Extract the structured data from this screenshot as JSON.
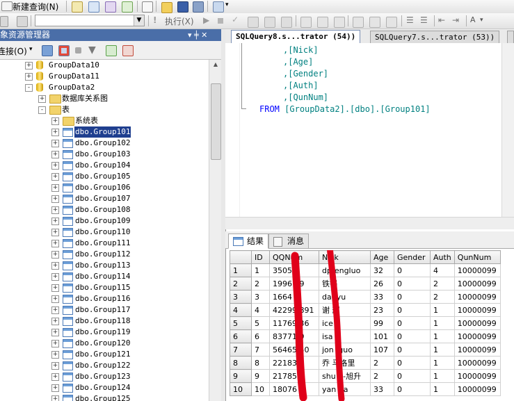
{
  "main_toolbar": {
    "new_query_label": "新建查询(N)"
  },
  "sql_toolbar": {
    "execute_label": "执行(X)"
  },
  "object_explorer": {
    "title": "对象资源管理器",
    "connect_label": "连接(O)",
    "dock_controls": "▾ ╪ ✕",
    "tree": [
      {
        "label": "GroupData10",
        "indent": 0,
        "expander": "+",
        "icon": "database-icon",
        "selected": false
      },
      {
        "label": "GroupData11",
        "indent": 0,
        "expander": "+",
        "icon": "database-icon",
        "selected": false
      },
      {
        "label": "GroupData2",
        "indent": 0,
        "expander": "-",
        "icon": "database-icon",
        "selected": false
      },
      {
        "label": "数据库关系图",
        "indent": 1,
        "expander": "+",
        "icon": "folder-icon",
        "selected": false
      },
      {
        "label": "表",
        "indent": 1,
        "expander": "-",
        "icon": "folder-icon",
        "selected": false
      },
      {
        "label": "系统表",
        "indent": 2,
        "expander": "+",
        "icon": "folder-icon",
        "selected": false
      },
      {
        "label": "dbo.Group101",
        "indent": 2,
        "expander": "+",
        "icon": "table-icon",
        "selected": true
      },
      {
        "label": "dbo.Group102",
        "indent": 2,
        "expander": "+",
        "icon": "table-icon",
        "selected": false
      },
      {
        "label": "dbo.Group103",
        "indent": 2,
        "expander": "+",
        "icon": "table-icon",
        "selected": false
      },
      {
        "label": "dbo.Group104",
        "indent": 2,
        "expander": "+",
        "icon": "table-icon",
        "selected": false
      },
      {
        "label": "dbo.Group105",
        "indent": 2,
        "expander": "+",
        "icon": "table-icon",
        "selected": false
      },
      {
        "label": "dbo.Group106",
        "indent": 2,
        "expander": "+",
        "icon": "table-icon",
        "selected": false
      },
      {
        "label": "dbo.Group107",
        "indent": 2,
        "expander": "+",
        "icon": "table-icon",
        "selected": false
      },
      {
        "label": "dbo.Group108",
        "indent": 2,
        "expander": "+",
        "icon": "table-icon",
        "selected": false
      },
      {
        "label": "dbo.Group109",
        "indent": 2,
        "expander": "+",
        "icon": "table-icon",
        "selected": false
      },
      {
        "label": "dbo.Group110",
        "indent": 2,
        "expander": "+",
        "icon": "table-icon",
        "selected": false
      },
      {
        "label": "dbo.Group111",
        "indent": 2,
        "expander": "+",
        "icon": "table-icon",
        "selected": false
      },
      {
        "label": "dbo.Group112",
        "indent": 2,
        "expander": "+",
        "icon": "table-icon",
        "selected": false
      },
      {
        "label": "dbo.Group113",
        "indent": 2,
        "expander": "+",
        "icon": "table-icon",
        "selected": false
      },
      {
        "label": "dbo.Group114",
        "indent": 2,
        "expander": "+",
        "icon": "table-icon",
        "selected": false
      },
      {
        "label": "dbo.Group115",
        "indent": 2,
        "expander": "+",
        "icon": "table-icon",
        "selected": false
      },
      {
        "label": "dbo.Group116",
        "indent": 2,
        "expander": "+",
        "icon": "table-icon",
        "selected": false
      },
      {
        "label": "dbo.Group117",
        "indent": 2,
        "expander": "+",
        "icon": "table-icon",
        "selected": false
      },
      {
        "label": "dbo.Group118",
        "indent": 2,
        "expander": "+",
        "icon": "table-icon",
        "selected": false
      },
      {
        "label": "dbo.Group119",
        "indent": 2,
        "expander": "+",
        "icon": "table-icon",
        "selected": false
      },
      {
        "label": "dbo.Group120",
        "indent": 2,
        "expander": "+",
        "icon": "table-icon",
        "selected": false
      },
      {
        "label": "dbo.Group121",
        "indent": 2,
        "expander": "+",
        "icon": "table-icon",
        "selected": false
      },
      {
        "label": "dbo.Group122",
        "indent": 2,
        "expander": "+",
        "icon": "table-icon",
        "selected": false
      },
      {
        "label": "dbo.Group123",
        "indent": 2,
        "expander": "+",
        "icon": "table-icon",
        "selected": false
      },
      {
        "label": "dbo.Group124",
        "indent": 2,
        "expander": "+",
        "icon": "table-icon",
        "selected": false
      },
      {
        "label": "dbo.Group125",
        "indent": 2,
        "expander": "+",
        "icon": "table-icon",
        "selected": false
      }
    ]
  },
  "editor": {
    "tabs": [
      {
        "label": "SQLQuery8.s...trator (54))",
        "active": true
      },
      {
        "label": "SQLQuery7.s...trator (53))",
        "active": false
      }
    ],
    "lines": [
      {
        "text": ",[Nick]",
        "indent": 5,
        "kind": "col"
      },
      {
        "text": ",[Age]",
        "indent": 5,
        "kind": "col"
      },
      {
        "text": ",[Gender]",
        "indent": 5,
        "kind": "col"
      },
      {
        "text": ",[Auth]",
        "indent": 5,
        "kind": "col"
      },
      {
        "text": ",[QunNum]",
        "indent": 5,
        "kind": "col"
      },
      {
        "keyword": "FROM",
        "text": "[GroupData2].[dbo].[Group101]",
        "indent": 1,
        "kind": "from"
      }
    ],
    "colors": {
      "keyword": "#0000ff",
      "gray": "#808080",
      "identifier": "#008080"
    }
  },
  "results": {
    "tab_results": "结果",
    "tab_messages": "消息",
    "columns": [
      "",
      "ID",
      "QQNum",
      "Nick",
      "Age",
      "Gender",
      "Auth",
      "QunNum"
    ],
    "rows": [
      [
        "1",
        "1",
        "3505",
        "dpfengluo",
        "32",
        "0",
        "4",
        "10000099"
      ],
      [
        "2",
        "2",
        "1996 99",
        "铁锅",
        "26",
        "0",
        "2",
        "10000099"
      ],
      [
        "3",
        "3",
        "1664 5",
        "dadyu",
        "33",
        "0",
        "2",
        "10000099"
      ],
      [
        "4",
        "4",
        "42299 891",
        "谢 辉",
        "23",
        "0",
        "1",
        "10000099"
      ],
      [
        "5",
        "5",
        "11769 36",
        "ice g",
        "99",
        "0",
        "1",
        "10000099"
      ],
      [
        "6",
        "6",
        "83771 9",
        "isa",
        "101",
        "0",
        "1",
        "10000099"
      ],
      [
        "7",
        "7",
        "56465 50",
        "jon iguo",
        "107",
        "0",
        "1",
        "10000099"
      ],
      [
        "8",
        "8",
        "22183 5",
        "乔 马洛里",
        "2",
        "0",
        "1",
        "10000099"
      ],
      [
        "9",
        "9",
        "21785 4",
        "shu n-旭升",
        "2",
        "0",
        "1",
        "10000099"
      ],
      [
        "10",
        "10",
        "18076",
        "yan ua",
        "33",
        "0",
        "1",
        "10000099"
      ]
    ],
    "redaction_color": "#e0001a"
  }
}
